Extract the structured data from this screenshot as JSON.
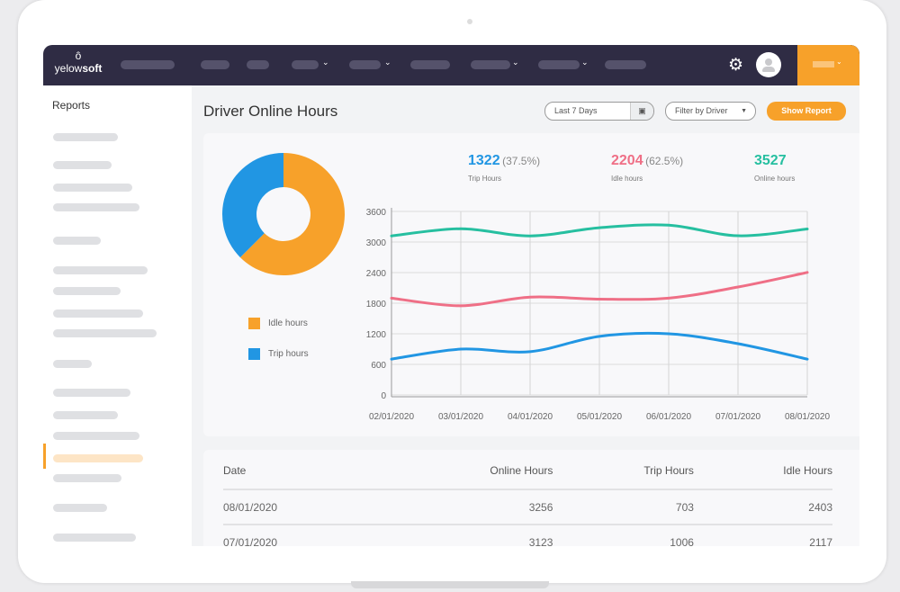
{
  "brand": {
    "name_light": "yelow",
    "name_bold": "soft"
  },
  "sidebar": {
    "title": "Reports"
  },
  "page": {
    "title": "Driver Online Hours"
  },
  "controls": {
    "date_range": "Last 7 Days",
    "driver_filter": "Filter by Driver",
    "show_report": "Show Report"
  },
  "stats": [
    {
      "value": "1322",
      "pct": "(37.5%)",
      "label": "Trip Hours",
      "color": "#2196e3"
    },
    {
      "value": "2204",
      "pct": "(62.5%)",
      "label": "Idle hours",
      "color": "#ef6f86"
    },
    {
      "value": "3527",
      "pct": "",
      "label": "Online hours",
      "color": "#26bfa0"
    }
  ],
  "donut": {
    "legend": [
      {
        "label": "Idle hours",
        "color": "#f7a12a",
        "pct": 62.5
      },
      {
        "label": "Trip hours",
        "color": "#2196e3",
        "pct": 37.5
      }
    ]
  },
  "chart_data": {
    "type": "line",
    "x": [
      "02/01/2020",
      "03/01/2020",
      "04/01/2020",
      "05/01/2020",
      "06/01/2020",
      "07/01/2020",
      "08/01/2020"
    ],
    "yticks": [
      0,
      600,
      1200,
      1800,
      2400,
      3000,
      3600
    ],
    "ylim": [
      0,
      3600
    ],
    "grid": true,
    "series": [
      {
        "key": "online",
        "color": "#26bfa0",
        "values": [
          3120,
          3260,
          3120,
          3280,
          3330,
          3123,
          3256
        ]
      },
      {
        "key": "idle",
        "color": "#ef6f86",
        "values": [
          1900,
          1750,
          1920,
          1880,
          1900,
          2117,
          2403
        ]
      },
      {
        "key": "trip",
        "color": "#2196e3",
        "values": [
          703,
          900,
          850,
          1150,
          1200,
          1006,
          703
        ]
      }
    ]
  },
  "table": {
    "headers": [
      "Date",
      "Online Hours",
      "Trip Hours",
      "Idle Hours"
    ],
    "rows": [
      [
        "08/01/2020",
        "3256",
        "703",
        "2403"
      ],
      [
        "07/01/2020",
        "3123",
        "1006",
        "2117"
      ]
    ]
  }
}
